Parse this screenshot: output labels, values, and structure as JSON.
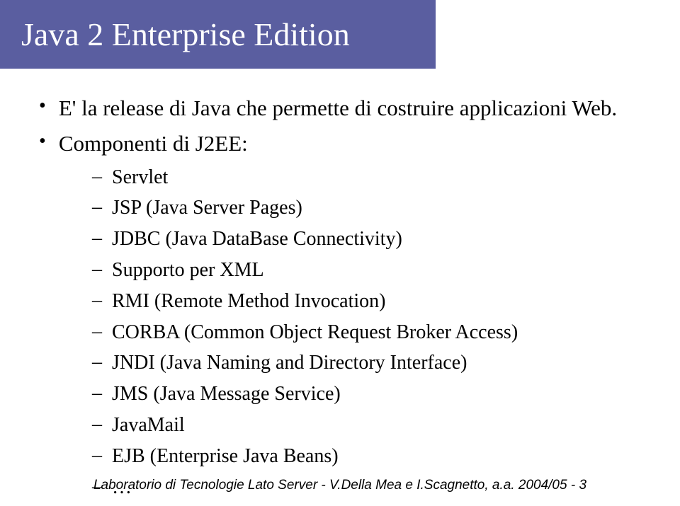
{
  "title": "Java 2 Enterprise Edition",
  "bullets": [
    {
      "text": "E' la release di Java che permette di costruire applicazioni Web."
    },
    {
      "text": "Componenti di J2EE:",
      "subitems": [
        "Servlet",
        "JSP (Java Server Pages)",
        "JDBC (Java DataBase Connectivity)",
        "Supporto per XML",
        "RMI (Remote Method Invocation)",
        "CORBA (Common Object Request Broker Access)",
        "JNDI (Java Naming and Directory Interface)",
        "JMS (Java Message Service)",
        "JavaMail",
        "EJB (Enterprise Java Beans)",
        "…"
      ]
    }
  ],
  "footer": "Laboratorio di Tecnologie Lato Server - V.Della Mea e I.Scagnetto, a.a. 2004/05 - 3"
}
